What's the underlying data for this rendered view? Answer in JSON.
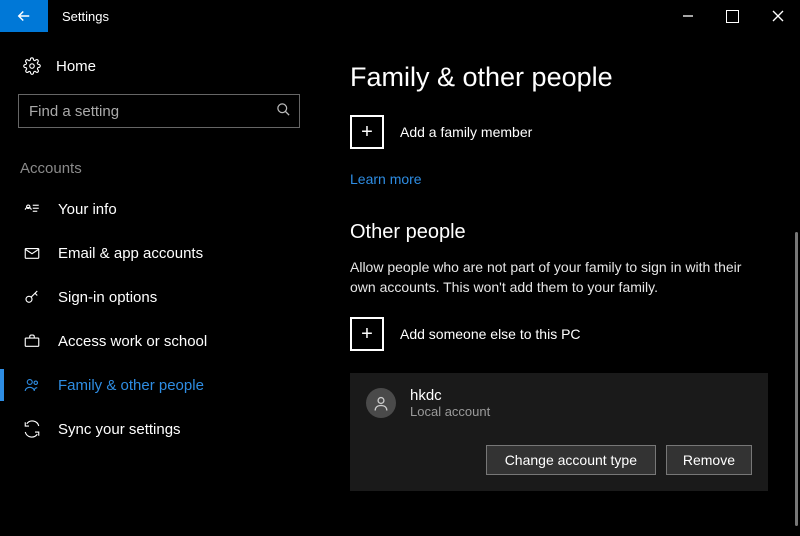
{
  "window": {
    "title": "Settings"
  },
  "sidebar": {
    "home": "Home",
    "search_placeholder": "Find a setting",
    "category": "Accounts",
    "items": [
      {
        "label": "Your info"
      },
      {
        "label": "Email & app accounts"
      },
      {
        "label": "Sign-in options"
      },
      {
        "label": "Access work or school"
      },
      {
        "label": "Family & other people"
      },
      {
        "label": "Sync your settings"
      }
    ]
  },
  "main": {
    "heading": "Family & other people",
    "add_family_label": "Add a family member",
    "learn_more": "Learn more",
    "other_heading": "Other people",
    "other_desc": "Allow people who are not part of your family to sign in with their own accounts. This won't add them to your family.",
    "add_other_label": "Add someone else to this PC",
    "person": {
      "name": "hkdc",
      "subtitle": "Local account",
      "change_btn": "Change account type",
      "remove_btn": "Remove"
    }
  }
}
